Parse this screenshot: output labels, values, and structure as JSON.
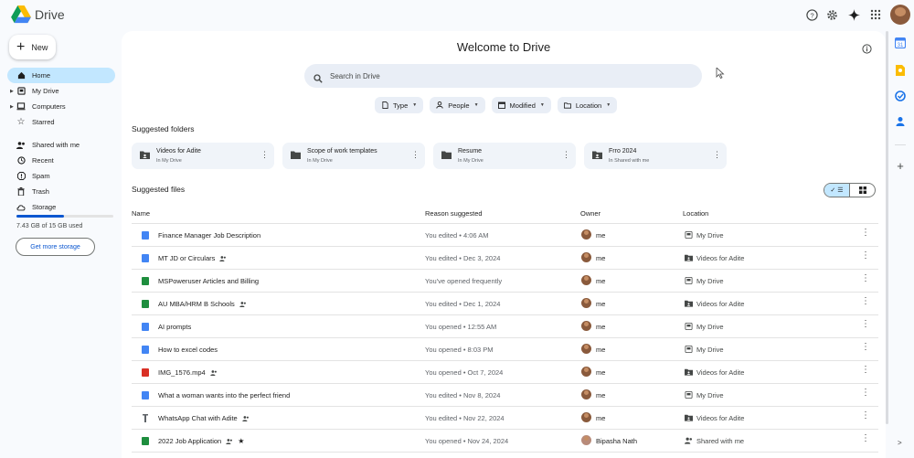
{
  "app": {
    "name": "Drive"
  },
  "new_button": {
    "label": "New"
  },
  "sidebar": {
    "items": [
      {
        "label": "Home",
        "icon": "home-icon",
        "active": true,
        "caret": false
      },
      {
        "label": "My Drive",
        "icon": "my-drive-icon",
        "active": false,
        "caret": true
      },
      {
        "label": "Computers",
        "icon": "computers-icon",
        "active": false,
        "caret": true
      },
      {
        "label": "Starred",
        "icon": "star-icon",
        "active": false,
        "caret": false
      },
      {
        "label": "Shared with me",
        "icon": "shared-icon",
        "active": false,
        "caret": false
      },
      {
        "label": "Recent",
        "icon": "clock-icon",
        "active": false,
        "caret": false
      },
      {
        "label": "Spam",
        "icon": "spam-icon",
        "active": false,
        "caret": false
      },
      {
        "label": "Trash",
        "icon": "trash-icon",
        "active": false,
        "caret": false
      },
      {
        "label": "Storage",
        "icon": "cloud-icon",
        "active": false,
        "caret": false
      }
    ],
    "storage_text": "7.43 GB of 15 GB used",
    "storage_fraction": 0.495,
    "get_storage_label": "Get more storage"
  },
  "main": {
    "title": "Welcome to Drive",
    "search_placeholder": "Search in Drive",
    "filters": [
      {
        "label": "Type",
        "icon": "file-icon"
      },
      {
        "label": "People",
        "icon": "person-icon"
      },
      {
        "label": "Modified",
        "icon": "calendar-icon"
      },
      {
        "label": "Location",
        "icon": "folder-icon"
      }
    ],
    "suggested_folders_title": "Suggested folders",
    "folders": [
      {
        "name": "Videos for Adite",
        "location": "In My Drive",
        "shared": true
      },
      {
        "name": "Scope of work templates",
        "location": "In My Drive",
        "shared": false
      },
      {
        "name": "Resume",
        "location": "In My Drive",
        "shared": false
      },
      {
        "name": "Frro 2024",
        "location": "In Shared with me",
        "shared": true
      }
    ],
    "suggested_files_title": "Suggested files",
    "table": {
      "columns": [
        "Name",
        "Reason suggested",
        "Owner",
        "Location"
      ],
      "rows": [
        {
          "name": "Finance Manager Job Description",
          "type": "doc",
          "shared": false,
          "starred": false,
          "reason": "You edited • 4:06 AM",
          "owner": "me",
          "location": "My Drive",
          "location_type": "drive"
        },
        {
          "name": "MT JD or Circulars",
          "type": "doc",
          "shared": true,
          "starred": false,
          "reason": "You edited • Dec 3, 2024",
          "owner": "me",
          "location": "Videos for Adite",
          "location_type": "shared-folder"
        },
        {
          "name": "MSPoweruser Articles and Billing",
          "type": "sheet",
          "shared": false,
          "starred": false,
          "reason": "You've opened frequently",
          "owner": "me",
          "location": "My Drive",
          "location_type": "drive"
        },
        {
          "name": "AU MBA/HRM B Schools",
          "type": "sheet",
          "shared": true,
          "starred": false,
          "reason": "You edited • Dec 1, 2024",
          "owner": "me",
          "location": "Videos for Adite",
          "location_type": "shared-folder"
        },
        {
          "name": "AI prompts",
          "type": "doc",
          "shared": false,
          "starred": false,
          "reason": "You opened • 12:55 AM",
          "owner": "me",
          "location": "My Drive",
          "location_type": "drive"
        },
        {
          "name": "How to excel codes",
          "type": "doc",
          "shared": false,
          "starred": false,
          "reason": "You opened • 8:03 PM",
          "owner": "me",
          "location": "My Drive",
          "location_type": "drive"
        },
        {
          "name": "IMG_1576.mp4",
          "type": "video",
          "shared": true,
          "starred": false,
          "reason": "You opened • Oct 7, 2024",
          "owner": "me",
          "location": "Videos for Adite",
          "location_type": "shared-folder"
        },
        {
          "name": "What a woman wants into the perfect friend",
          "type": "doc",
          "shared": false,
          "starred": false,
          "reason": "You edited • Nov 8, 2024",
          "owner": "me",
          "location": "My Drive",
          "location_type": "drive"
        },
        {
          "name": "WhatsApp Chat with Adite",
          "type": "text",
          "shared": true,
          "starred": false,
          "reason": "You edited • Nov 22, 2024",
          "owner": "me",
          "location": "Videos for Adite",
          "location_type": "shared-folder"
        },
        {
          "name": "2022 Job Application",
          "type": "sheet",
          "shared": true,
          "starred": true,
          "reason": "You opened • Nov 24, 2024",
          "owner": "Bipasha Nath",
          "location": "Shared with me",
          "location_type": "shared-with-me"
        }
      ]
    }
  },
  "colors": {
    "accent": "#0b57d0",
    "active_nav": "#c2e7ff",
    "doc": "#4285f4",
    "sheet": "#1e8e3e",
    "video": "#d93025"
  }
}
